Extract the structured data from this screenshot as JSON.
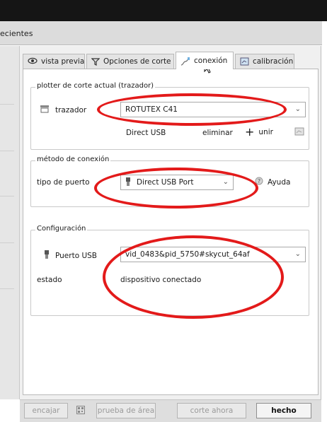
{
  "header": {
    "recent_label": "ecientes"
  },
  "tabs": [
    {
      "label": "vista previa",
      "icon": "eye-icon"
    },
    {
      "label": "Opciones de corte",
      "icon": "cut-options-icon"
    },
    {
      "label": "conexión",
      "icon": "connection-icon",
      "active": true
    },
    {
      "label": "calibración",
      "icon": "calibration-icon"
    }
  ],
  "plotter_group": {
    "legend": "plotter de corte actual (trazador)",
    "label": "trazador",
    "selected": "ROTUTEX C41",
    "connection_type": "Direct USB",
    "remove_label": "eliminar",
    "add_label": "unir"
  },
  "connection_group": {
    "legend": "método de conexión",
    "port_type_label": "tipo de puerto",
    "port_selected": "Direct USB Port",
    "help_label": "Ayuda"
  },
  "config_group": {
    "legend": "Configuración",
    "usb_port_label": "Puerto USB",
    "usb_port_value": "vid_0483&pid_5750#skycut_64af",
    "status_label": "estado",
    "status_value": "dispositivo conectado"
  },
  "footer": {
    "fit_label": "encajar",
    "test_label": "prueba de área",
    "cut_label": "corte ahora",
    "done_label": "hecho"
  },
  "colors": {
    "annotation": "#e31a1a"
  }
}
